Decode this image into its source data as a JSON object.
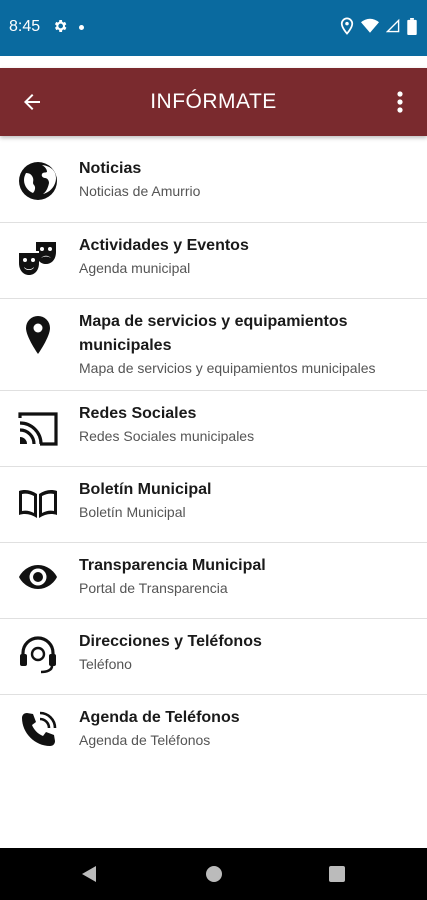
{
  "status_bar": {
    "time": "8:45",
    "icons": [
      "gear-icon",
      "dot-icon",
      "location-icon",
      "wifi-icon",
      "signal-icon",
      "battery-icon"
    ]
  },
  "app_bar": {
    "title": "INFÓRMATE",
    "back_icon": "arrow-back-icon",
    "menu_icon": "more-vert-icon",
    "background": "#7a2a2e"
  },
  "status_bar_color": "#0a6a9f",
  "items": [
    {
      "title": "Noticias",
      "subtitle": "Noticias de Amurrio",
      "icon": "globe-icon"
    },
    {
      "title": "Actividades y Eventos",
      "subtitle": "Agenda municipal",
      "icon": "theater-masks-icon"
    },
    {
      "title": "Mapa de servicios y equipamientos municipales",
      "subtitle": "Mapa de servicios y equipamientos municipales",
      "icon": "map-pin-icon"
    },
    {
      "title": "Redes Sociales",
      "subtitle": "Redes Sociales municipales",
      "icon": "cast-icon"
    },
    {
      "title": "Boletín Municipal",
      "subtitle": "Boletín Municipal",
      "icon": "book-icon"
    },
    {
      "title": "Transparencia Municipal",
      "subtitle": "Portal de Transparencia",
      "icon": "eye-icon"
    },
    {
      "title": "Direcciones y Teléfonos",
      "subtitle": "Teléfono",
      "icon": "headset-icon"
    },
    {
      "title": "Agenda de Teléfonos",
      "subtitle": "Agenda de Teléfonos",
      "icon": "phone-call-icon"
    }
  ],
  "nav_bar": {
    "buttons": [
      "back-triangle-icon",
      "home-circle-icon",
      "recents-square-icon"
    ]
  }
}
